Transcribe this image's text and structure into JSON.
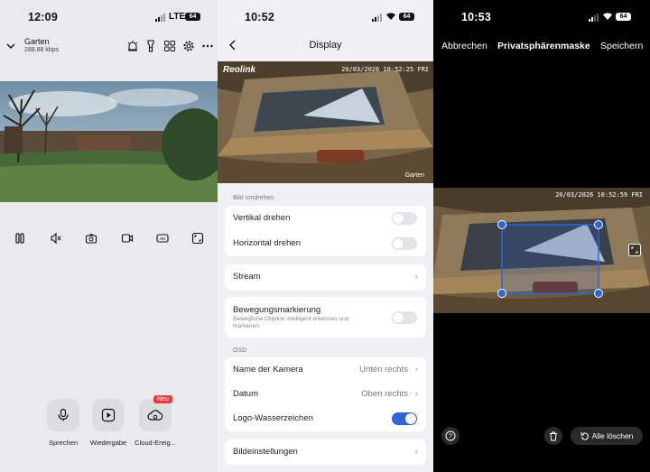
{
  "colors": {
    "accent": "#2c66d8",
    "badge": "#e83a3a",
    "mask_handle": "#2c66d8"
  },
  "panel1": {
    "status": {
      "time": "12:09",
      "carrier": "LTE",
      "battery": "64"
    },
    "header": {
      "camera_name": "Garten",
      "bitrate": "288.88 kbps",
      "icons": [
        "chevron-down-icon",
        "siren-icon",
        "flashlight-icon",
        "grid-icon",
        "gear-icon",
        "more-icon"
      ]
    },
    "controls": [
      "pause-icon",
      "speaker-mute-icon",
      "snapshot-icon",
      "record-icon",
      "quality-icon",
      "fullscreen-icon"
    ],
    "actions": [
      {
        "label": "Sprechen",
        "icon": "microphone-icon"
      },
      {
        "label": "Wiedergabe",
        "icon": "play-icon"
      },
      {
        "label": "Cloud-Ereig...",
        "icon": "cloud-icon"
      }
    ],
    "new_badge": "Neu"
  },
  "panel2": {
    "status": {
      "time": "10:52",
      "battery": "64"
    },
    "title": "Display",
    "preview": {
      "logo": "Reolink",
      "timestamp": "20/03/2026 10:52:25 FRI",
      "watermark": "Garten"
    },
    "section_flip": "Bild umdrehen",
    "vertical": {
      "label": "Vertikal drehen",
      "on": false
    },
    "horizontal": {
      "label": "Horizontal drehen",
      "on": false
    },
    "stream": {
      "label": "Stream"
    },
    "motion": {
      "label": "Bewegungsmarkierung",
      "desc": "Bewegliche Objekte intelligent erkennen und markieren.",
      "on": false
    },
    "section_osd": "OSD",
    "camera_name": {
      "label": "Name der Kamera",
      "value": "Unten rechts"
    },
    "date": {
      "label": "Datum",
      "value": "Oben rechts"
    },
    "logo_wm": {
      "label": "Logo-Wasserzeichen",
      "on": true
    },
    "image_settings": {
      "label": "Bildeinstellungen"
    }
  },
  "panel3": {
    "status": {
      "time": "10:53",
      "battery": "64"
    },
    "cancel": "Abbrechen",
    "title": "Privatsphärenmaske",
    "save": "Speichern",
    "timestamp": "20/03/2026 10:52:59 FRI",
    "delete_all": "Alle löschen"
  }
}
